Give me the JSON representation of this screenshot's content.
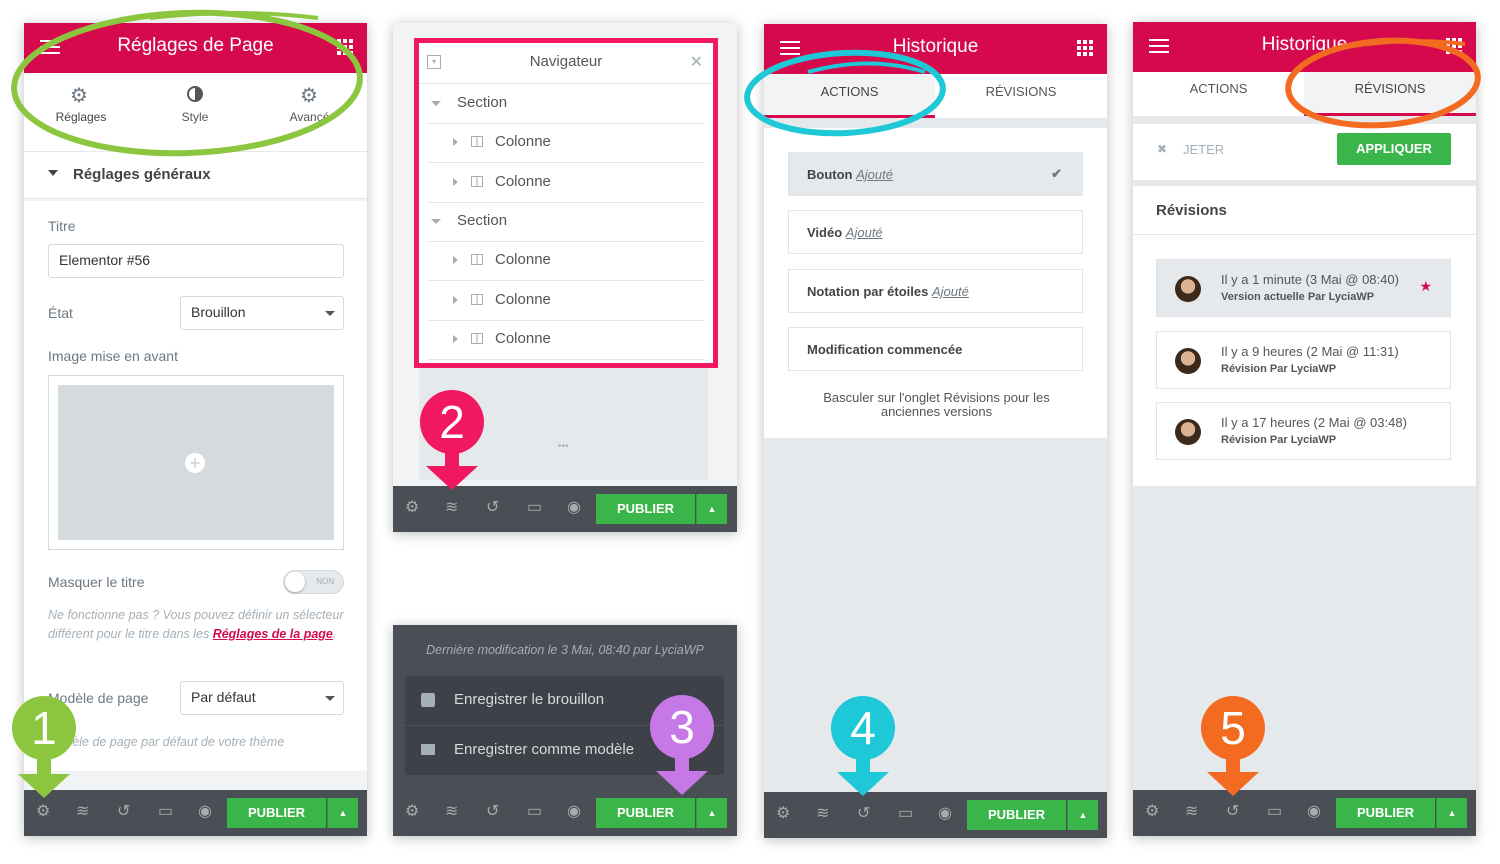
{
  "colors": {
    "brand": "#d5094c",
    "publish": "#39b54a",
    "green": "#8cc63f",
    "pink": "#f0185f",
    "purple": "#c678e6",
    "cyan": "#1ec8d6",
    "orange": "#f26b21"
  },
  "common": {
    "publish_label": "PUBLIER"
  },
  "panel1": {
    "title": "Réglages de Page",
    "tabs": [
      {
        "label": "Réglages",
        "icon": "gear-icon"
      },
      {
        "label": "Style",
        "icon": "contrast-icon"
      },
      {
        "label": "Avancé",
        "icon": "gear-icon"
      }
    ],
    "section_title": "Réglages généraux",
    "title_label": "Titre",
    "title_value": "Elementor #56",
    "state_label": "État",
    "state_value": "Brouillon",
    "featured_image_label": "Image mise en avant",
    "hide_title_label": "Masquer le titre",
    "hide_title_toggle": "NON",
    "help_text": "Ne fonctionne pas ? Vous pouvez définir un sélecteur différent pour le titre dans les",
    "help_link": "Réglages de la page",
    "template_label": "Modèle de page",
    "template_value": "Par défaut",
    "template_help": "Modèle de page par défaut de votre thème",
    "badge": "1"
  },
  "panel2": {
    "title": "Navigateur",
    "items": [
      {
        "label": "Section",
        "type": "section"
      },
      {
        "label": "Colonne",
        "type": "column"
      },
      {
        "label": "Colonne",
        "type": "column"
      },
      {
        "label": "Section",
        "type": "section"
      },
      {
        "label": "Colonne",
        "type": "column"
      },
      {
        "label": "Colonne",
        "type": "column"
      },
      {
        "label": "Colonne",
        "type": "column"
      }
    ],
    "badge": "2"
  },
  "panel3": {
    "last_modified": "Dernière modification le 3 Mai, 08:40 par LyciaWP",
    "save_draft": "Enregistrer le brouillon",
    "save_template": "Enregistrer comme modèle",
    "badge": "3"
  },
  "panel4": {
    "title": "Historique",
    "tabs": [
      "ACTIONS",
      "RÉVISIONS"
    ],
    "items": [
      {
        "name": "Bouton",
        "action": "Ajouté"
      },
      {
        "name": "Vidéo",
        "action": "Ajouté"
      },
      {
        "name": "Notation par étoiles",
        "action": "Ajouté"
      },
      {
        "name": "Modification commencée",
        "action": ""
      }
    ],
    "hint": "Basculer sur l'onglet Révisions pour les anciennes versions",
    "badge": "4"
  },
  "panel5": {
    "title": "Historique",
    "tabs": [
      "ACTIONS",
      "RÉVISIONS"
    ],
    "discard": "JETER",
    "apply": "APPLIQUER",
    "revisions_title": "Révisions",
    "revisions": [
      {
        "time": "Il y a 1 minute (3 Mai @ 08:40)",
        "desc": "Version actuelle Par LyciaWP"
      },
      {
        "time": "Il y a 9 heures (2 Mai @ 11:31)",
        "desc": "Révision Par LyciaWP"
      },
      {
        "time": "Il y a 17 heures (2 Mai @ 03:48)",
        "desc": "Révision Par LyciaWP"
      }
    ],
    "badge": "5"
  }
}
